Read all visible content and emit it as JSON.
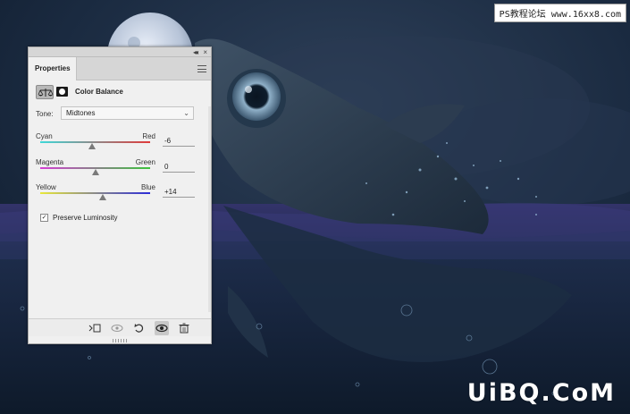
{
  "panel": {
    "tab_title": "Properties",
    "adjustment_title": "Color Balance",
    "tone_label": "Tone:",
    "tone_value": "Midtones",
    "sliders": [
      {
        "left": "Cyan",
        "right": "Red",
        "value": "-6",
        "position": -6,
        "min": -100,
        "max": 100,
        "gradient": [
          "#3fd8d8",
          "#e03a3a"
        ]
      },
      {
        "left": "Magenta",
        "right": "Green",
        "value": "0",
        "position": 0,
        "min": -100,
        "max": 100,
        "gradient": [
          "#d43fd4",
          "#3cc33c"
        ]
      },
      {
        "left": "Yellow",
        "right": "Blue",
        "value": "+14",
        "position": 14,
        "min": -100,
        "max": 100,
        "gradient": [
          "#e8e83a",
          "#2c2cd8"
        ]
      }
    ],
    "preserve_luminosity_label": "Preserve Luminosity",
    "preserve_luminosity_checked": true,
    "preserve_check_glyph": "✓",
    "collapse_glyph": "◂◂",
    "close_glyph": "×",
    "tone_caret": "⌄",
    "icons": [
      "color-balance-icon",
      "layer-mask-icon",
      "panel-menu-icon",
      "clip-to-layer-icon",
      "view-previous-state-icon",
      "reset-icon",
      "toggle-visibility-icon",
      "delete-icon"
    ]
  },
  "watermarks": {
    "top": "PS教程论坛 www.16xx8.com",
    "bottom": "UiBQ.CoM"
  },
  "colors": {
    "panel_bg": "#f0f0f0",
    "panel_header": "#d6d6d6",
    "night_sky": "#17283d",
    "water": "#1a2a44"
  }
}
